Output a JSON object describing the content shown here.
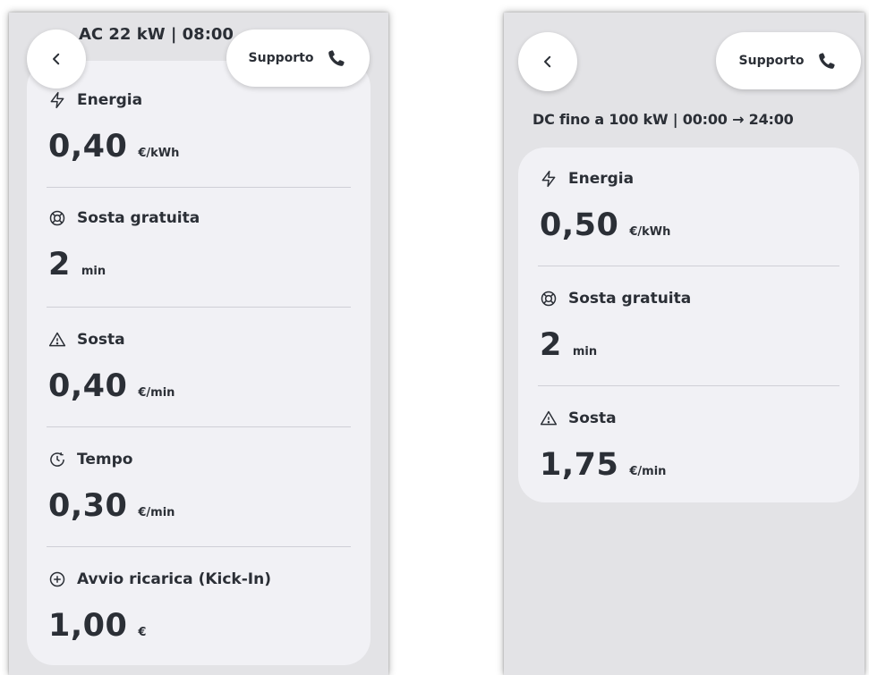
{
  "left": {
    "title": "AC 22 kW | 08:00",
    "support_label": "Supporto",
    "sections": [
      {
        "icon": "bolt-icon",
        "label": "Energia",
        "value": "0,40",
        "unit": "€/kWh"
      },
      {
        "icon": "lifebuoy-icon",
        "label": "Sosta gratuita",
        "value": "2",
        "unit": "min"
      },
      {
        "icon": "warning-icon",
        "label": "Sosta",
        "value": "0,40",
        "unit": "€/min"
      },
      {
        "icon": "clock-icon",
        "label": "Tempo",
        "value": "0,30",
        "unit": "€/min"
      },
      {
        "icon": "plus-circle-icon",
        "label": "Avvio ricarica (Kick-In)",
        "value": "1,00",
        "unit": "€"
      }
    ]
  },
  "right": {
    "title": "DC fino a 100 kW | 00:00 → 24:00",
    "support_label": "Supporto",
    "sections": [
      {
        "icon": "bolt-icon",
        "label": "Energia",
        "value": "0,50",
        "unit": "€/kWh"
      },
      {
        "icon": "lifebuoy-icon",
        "label": "Sosta gratuita",
        "value": "2",
        "unit": "min"
      },
      {
        "icon": "warning-icon",
        "label": "Sosta",
        "value": "1,75",
        "unit": "€/min"
      }
    ]
  },
  "colors": {
    "text": "#2b2f36",
    "card": "#f1f1f5",
    "screen": "#e3e3e6",
    "divider": "#cfcfd6"
  }
}
